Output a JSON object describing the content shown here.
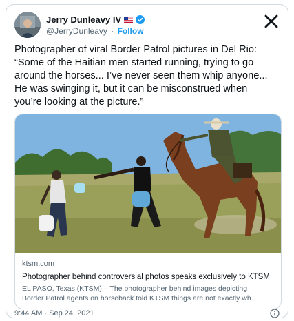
{
  "tweet": {
    "author": {
      "name": "Jerry Dunleavy IV",
      "handle": "@JerryDunleavy",
      "separator": "·",
      "follow_label": "Follow"
    },
    "text_lines": [
      "Photographer of viral Border Patrol pictures in Del Rio:",
      "“Some of the Haitian men started running, trying to go",
      "around the horses... I’ve never seen them whip anyone...",
      "He was swinging it, but it can be misconstrued when",
      "you’re looking at the picture.”"
    ],
    "card": {
      "domain": "ktsm.com",
      "title": "Photographer behind controversial photos speaks exclusively to KTSM",
      "description_lines": [
        "EL PASO, Texas (KTSM) – The photographer behind images depicting",
        "Border Patrol agents on horseback told KTSM things are not exactly wh..."
      ]
    },
    "timestamp": "9:44 AM · Sep 24, 2021"
  },
  "icons": {
    "verified": "verified-badge-icon",
    "flag": "us-flag-icon",
    "platform": "x-logo-icon",
    "info": "info-icon"
  },
  "colors": {
    "accent": "#1d9bf0",
    "secondary_text": "#536471",
    "border": "#cfd9de"
  }
}
